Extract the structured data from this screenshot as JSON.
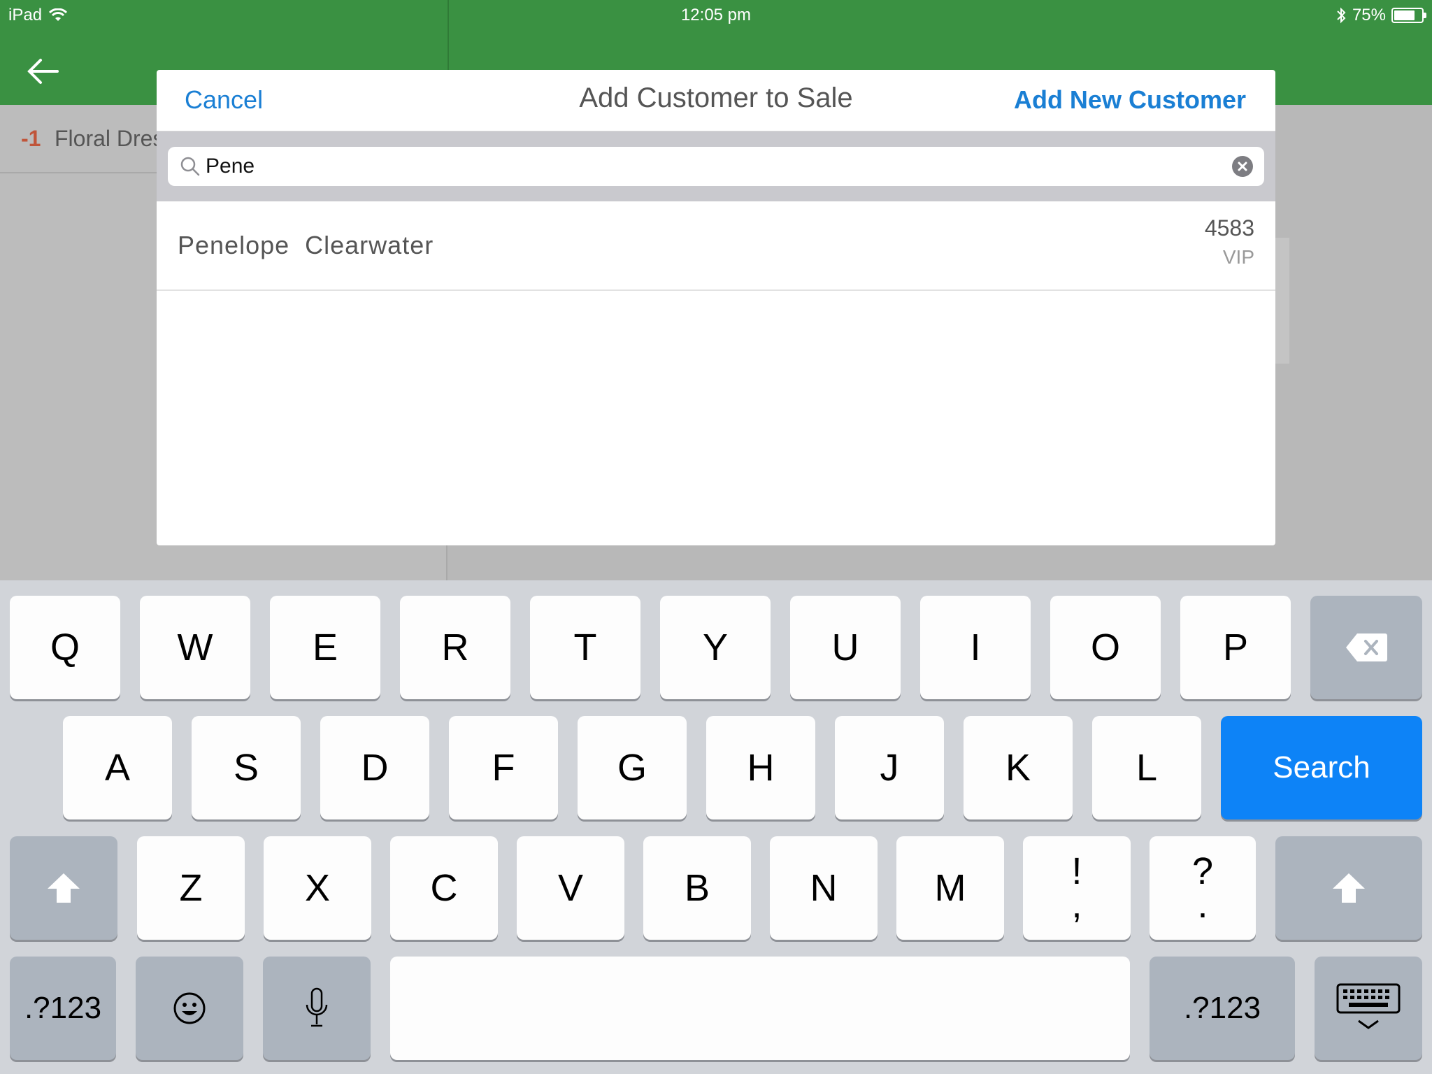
{
  "status_bar": {
    "device": "iPad",
    "time": "12:05 pm",
    "battery_percent": "75%",
    "battery_level": 0.75,
    "icons": [
      "wifi-icon",
      "bluetooth-icon",
      "battery-icon"
    ]
  },
  "background": {
    "header_color": "#3a9142",
    "line_item": {
      "quantity": "-1",
      "name": "Floral Dres"
    }
  },
  "modal": {
    "cancel_label": "Cancel",
    "title": "Add Customer to Sale",
    "add_new_label": "Add New Customer",
    "search": {
      "value": "Pene",
      "placeholder": ""
    },
    "results": [
      {
        "name": "Penelope  Clearwater",
        "id": "4583",
        "tag": "VIP"
      }
    ],
    "accent_color": "#1a7fd4"
  },
  "keyboard": {
    "row1": [
      "Q",
      "W",
      "E",
      "R",
      "T",
      "Y",
      "U",
      "I",
      "O",
      "P"
    ],
    "row2": [
      "A",
      "S",
      "D",
      "F",
      "G",
      "H",
      "J",
      "K",
      "L"
    ],
    "row3": [
      "Z",
      "X",
      "C",
      "V",
      "B",
      "N",
      "M"
    ],
    "punct1": {
      "top": "!",
      "bottom": ","
    },
    "punct2": {
      "top": "?",
      "bottom": "."
    },
    "search_label": "Search",
    "numbers_label": ".?123",
    "search_color": "#0d83f7"
  }
}
